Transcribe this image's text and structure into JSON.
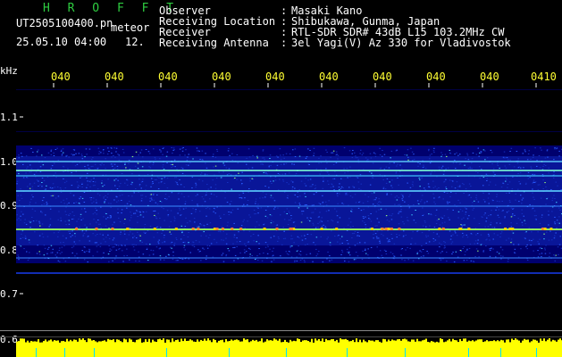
{
  "header": {
    "brand": "H R O F F T",
    "filename": "UT2505100400.pn",
    "filetag": "meteor",
    "datetime": "25.05.10 04:00",
    "number": "12.",
    "info": [
      {
        "label": "Observer",
        "value": "Masaki Kano"
      },
      {
        "label": "Receiving Location",
        "value": "Shibukawa, Gunma, Japan"
      },
      {
        "label": "Receiver",
        "value": "RTL-SDR SDR# 43dB L15 103.2MHz CW"
      },
      {
        "label": "Receiving Antenna",
        "value": "3el Yagi(V) Az 330 for Vladivostok"
      }
    ],
    "colon": ":"
  },
  "time_ticks": [
    "040",
    "040",
    "040",
    "040",
    "040",
    "040",
    "040",
    "040",
    "040",
    "0410"
  ],
  "yaxis": {
    "unit": "kHz",
    "labels": [
      "1.1",
      "1.0",
      "0.9",
      "0.8",
      "0.7",
      "0.6"
    ]
  },
  "colors": {
    "background": "#000000",
    "spectrum_base": "#00006e",
    "signal": "#22aaff",
    "hot": "#ffcc00",
    "baseline_strip": "#ffff00",
    "tick_text": "#ffff33"
  }
}
